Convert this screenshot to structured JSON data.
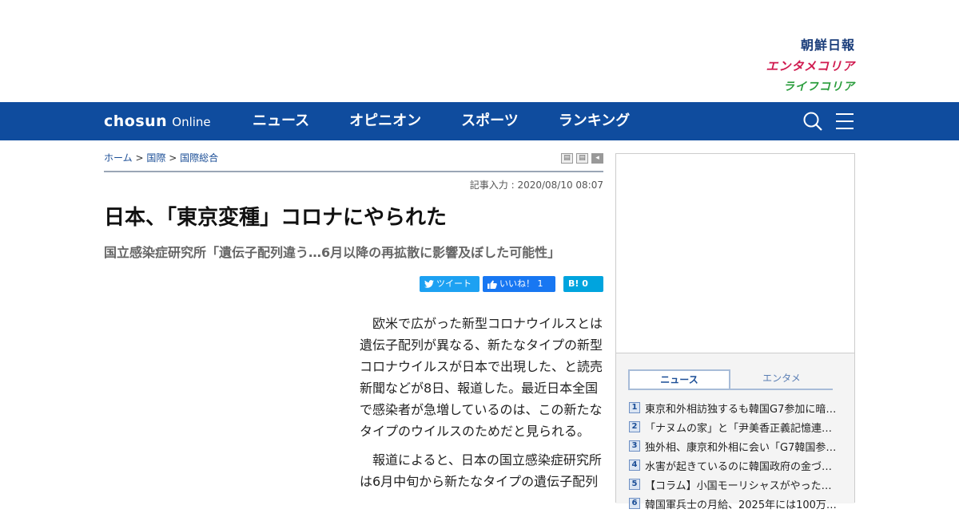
{
  "brands": {
    "chosun_ilbo": "朝鮮日報",
    "entame_korea": "エンタメコリア",
    "life_korea": "ライフコリア"
  },
  "nav": {
    "logo_main": "chosun",
    "logo_sub": "Online",
    "items": [
      "ニュース",
      "オピニオン",
      "スポーツ",
      "ランキング"
    ]
  },
  "breadcrumb": {
    "home": "ホーム",
    "sep": ">",
    "cat1": "国際",
    "cat2": "国際総合"
  },
  "article": {
    "date": "記事入力 : 2020/08/10 08:07",
    "headline": "日本、「東京変種」コロナにやられた",
    "subhead": "国立感染症研究所「遺伝子配列違う…6月以降の再拡散に影響及ぼした可能性」",
    "share": {
      "tweet": "ツイート",
      "like": "いいね！ 1",
      "hatena": "B! 0"
    },
    "paragraphs": [
      "欧米で広がった新型コロナウイルスとは遺伝子配列が異なる、新たなタイプの新型コロナウイルスが日本で出現した、と読売新聞などが8日、報道した。最近日本全国で感染者が急増しているのは、この新たなタイプのウイルスのためだと見られる。",
      "報道によると、日本の国立感染症研究所は6月中旬から新たなタイプの遺伝子配列"
    ]
  },
  "sidebar": {
    "tabs": [
      "ニュース",
      "エンタメ"
    ],
    "ranking": [
      {
        "num": "1",
        "title": "東京和外相訪独するも韓国G7参加に暗…"
      },
      {
        "num": "2",
        "title": "「ナヌムの家」と「尹美香正義記憶連…"
      },
      {
        "num": "3",
        "title": "独外相、康京和外相に会い「G7韓国参…"
      },
      {
        "num": "4",
        "title": "水害が起きているのに韓国政府の金づ…"
      },
      {
        "num": "5",
        "title": "【コラム】小国モーリシャスがやった…"
      },
      {
        "num": "6",
        "title": "韓国軍兵士の月給、2025年には100万…"
      }
    ]
  }
}
